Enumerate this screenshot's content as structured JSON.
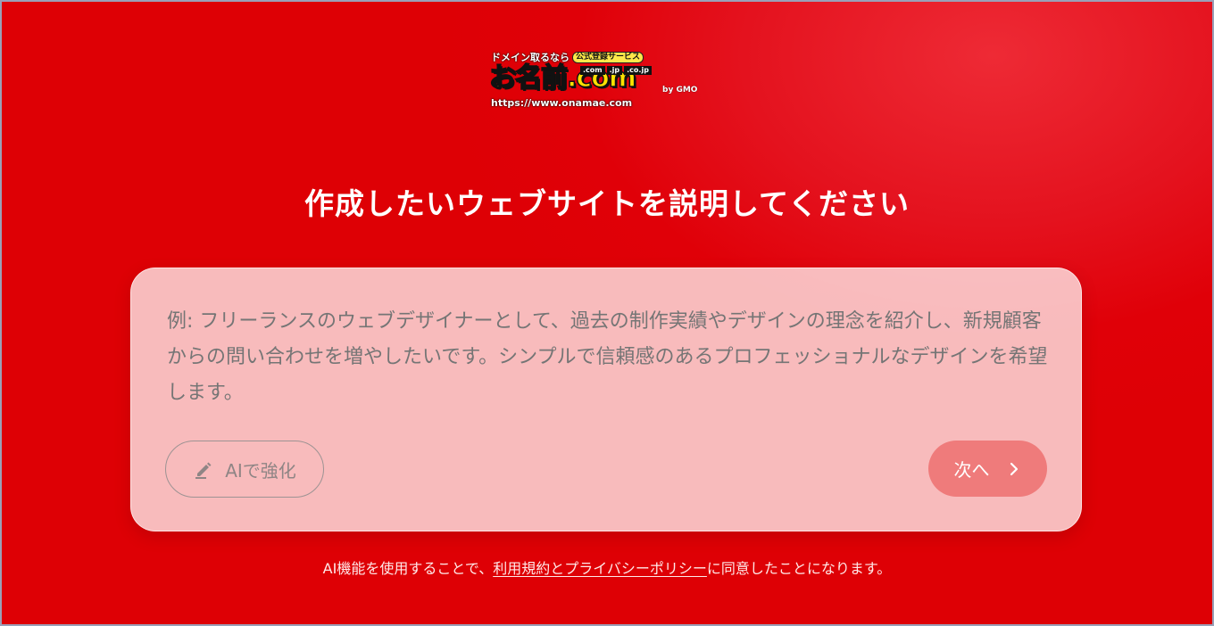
{
  "logo": {
    "tagline": "ドメイン取るなら",
    "service_badge": "公式登録サービス",
    "brand": "お名前.com",
    "tlds": [
      ".com",
      ".jp",
      ".co.jp"
    ],
    "by": "by GMO",
    "url": "https://www.onamae.com"
  },
  "heading": "作成したいウェブサイトを説明してください",
  "prompt": {
    "value": "",
    "placeholder": "例: フリーランスのウェブデザイナーとして、過去の制作実績やデザインの理念を紹介し、新規顧客からの問い合わせを増やしたいです。シンプルで信頼感のあるプロフェッショナルなデザインを希望します。"
  },
  "buttons": {
    "enhance_label": "AIで強化",
    "enhance_icon": "pencil-icon",
    "next_label": "次へ",
    "next_icon": "chevron-right-icon"
  },
  "footer": {
    "prefix": "AI機能を使用することで、",
    "link": "利用規約とプライバシーポリシー",
    "suffix": "に同意したことになります。"
  },
  "colors": {
    "background": "#e00008",
    "next_button": "#ef7b7b",
    "logo_yellow": "#ffe100"
  }
}
